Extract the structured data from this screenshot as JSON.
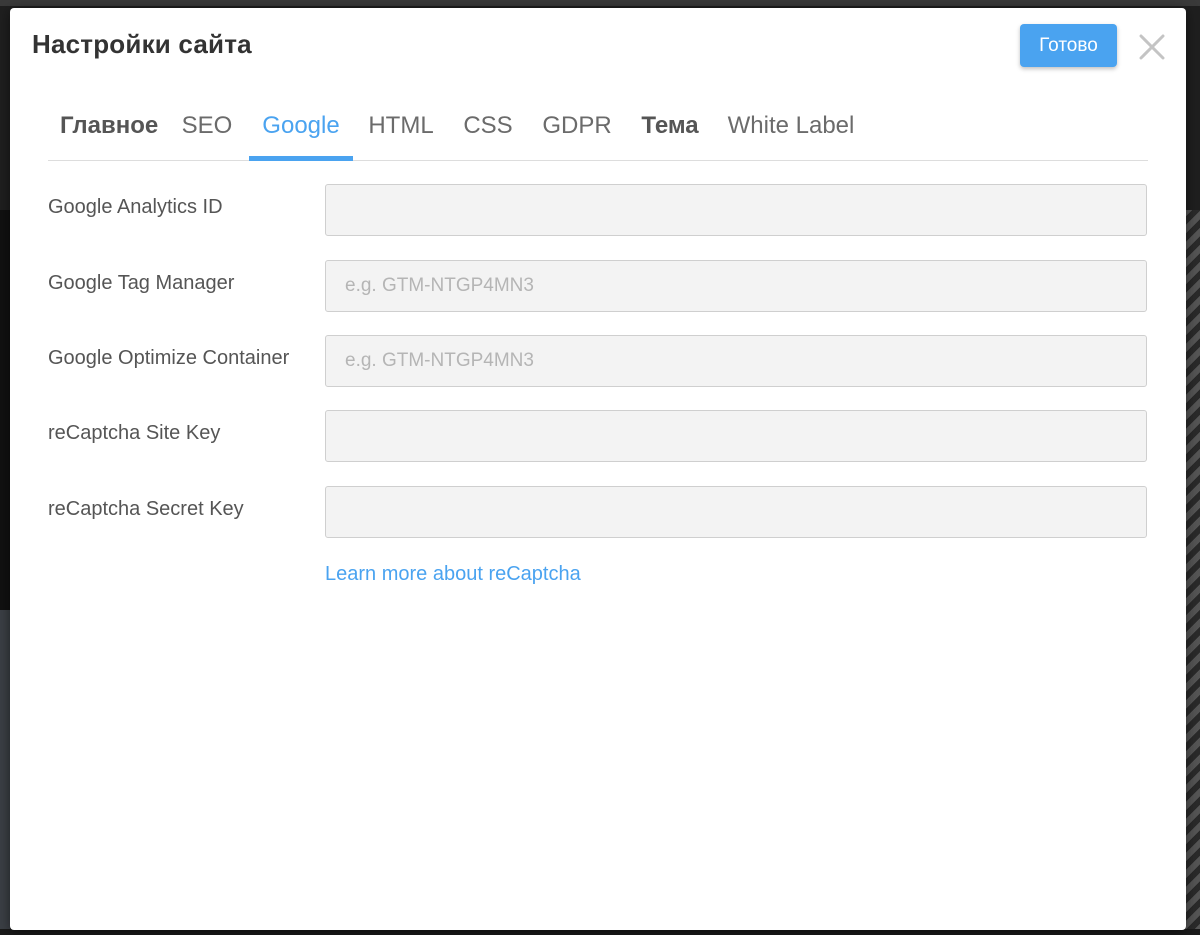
{
  "dialog": {
    "title": "Настройки сайта",
    "done_label": "Готово",
    "close_icon": "close-icon"
  },
  "tabs": [
    {
      "label": "Главное",
      "bold": true,
      "active": false
    },
    {
      "label": "SEO",
      "bold": false,
      "active": false
    },
    {
      "label": "Google",
      "bold": false,
      "active": true
    },
    {
      "label": "HTML",
      "bold": false,
      "active": false
    },
    {
      "label": "CSS",
      "bold": false,
      "active": false
    },
    {
      "label": "GDPR",
      "bold": false,
      "active": false
    },
    {
      "label": "Тема",
      "bold": true,
      "active": false
    },
    {
      "label": "White Label",
      "bold": false,
      "active": false
    }
  ],
  "fields": [
    {
      "label": "Google Analytics ID",
      "value": "",
      "placeholder": ""
    },
    {
      "label": "Google Tag Manager",
      "value": "",
      "placeholder": "e.g. GTM-NTGP4MN3"
    },
    {
      "label": "Google Optimize Container",
      "value": "",
      "placeholder": "e.g. GTM-NTGP4MN3"
    },
    {
      "label": "reCaptcha Site Key",
      "value": "",
      "placeholder": ""
    },
    {
      "label": "reCaptcha Secret Key",
      "value": "",
      "placeholder": ""
    }
  ],
  "learn_more_label": "Learn more about reCaptcha",
  "colors": {
    "accent": "#4aa3f0",
    "input_bg": "#f3f3f3",
    "label": "#555555"
  }
}
